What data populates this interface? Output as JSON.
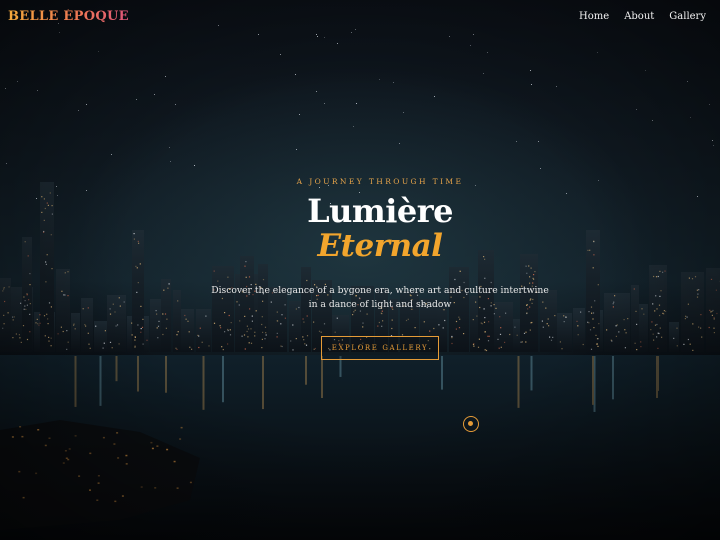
{
  "app": {
    "logo_text": "BELLE ÉPOQUE"
  },
  "nav": {
    "items": [
      {
        "label": "Home"
      },
      {
        "label": "About"
      },
      {
        "label": "Gallery"
      }
    ]
  },
  "hero": {
    "eyebrow": "A JOURNEY THROUGH TIME",
    "title_line1": "Lumière",
    "title_line2": "Eternal",
    "subtitle": "Discover the elegance of a bygone era, where art and culture intertwine in a dance of light and shadow",
    "cta_label": "EXPLORE GALLERY"
  },
  "colors": {
    "accent": "#e59b37",
    "title_accent": "#f2a52d",
    "logo_gradient_start": "#f3a93b",
    "logo_gradient_end": "#e0557a",
    "background": "#0b0f14"
  },
  "icons": {
    "scroll_indicator": "scroll-down-circle-icon"
  }
}
